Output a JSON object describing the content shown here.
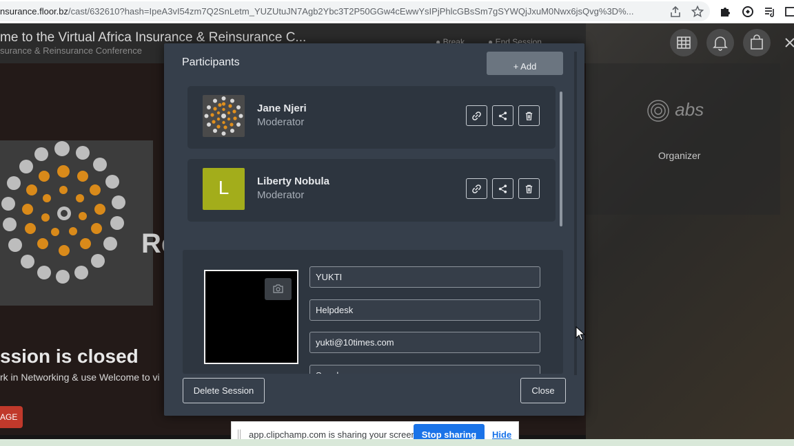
{
  "browser": {
    "url_host": "nsurance.floor.bz",
    "url_path": "/cast/632610?hash=IpeA3vI54zm7Q2SnLetm_YUZUtuJN7Agb2Ybc3T2P50GGw4cEwwYsIPjPhlcGBsSm7gSYWQjJxuM0Nwx6jsQvg%3D%..."
  },
  "background": {
    "event_title": "me to the Virtual Africa Insurance & Reinsurance C...",
    "event_subtitle": "surance & Reinsurance Conference",
    "break_label": "Break",
    "end_session_label": "End Session",
    "re_fragment": "Re",
    "closed_heading": "ssion is closed",
    "closed_sub": "rk in Networking & use Welcome to vi",
    "stage_button": "AGE",
    "organizer_label": "Organizer",
    "organizer_logo": "abs"
  },
  "modal": {
    "title": "Participants",
    "add_label": "+ Add",
    "participants": [
      {
        "name": "Jane Njeri",
        "role": "Moderator"
      },
      {
        "name": "Liberty Nobula",
        "role": "Moderator",
        "initial": "L"
      }
    ],
    "form": {
      "name_value": "YUKTI",
      "role_value": "Helpdesk",
      "email_value": "yukti@10times.com",
      "extra_value": "Speaker"
    },
    "delete_label": "Delete Session",
    "close_label": "Close"
  },
  "share_bar": {
    "message": "app.clipchamp.com is sharing your screen.",
    "stop_label": "Stop sharing",
    "hide_label": "Hide"
  },
  "colors": {
    "modal_bg": "#363f4b",
    "card_bg": "#2d353f",
    "avatar_green": "#a3ad1b",
    "stop_blue": "#1a73e8"
  }
}
